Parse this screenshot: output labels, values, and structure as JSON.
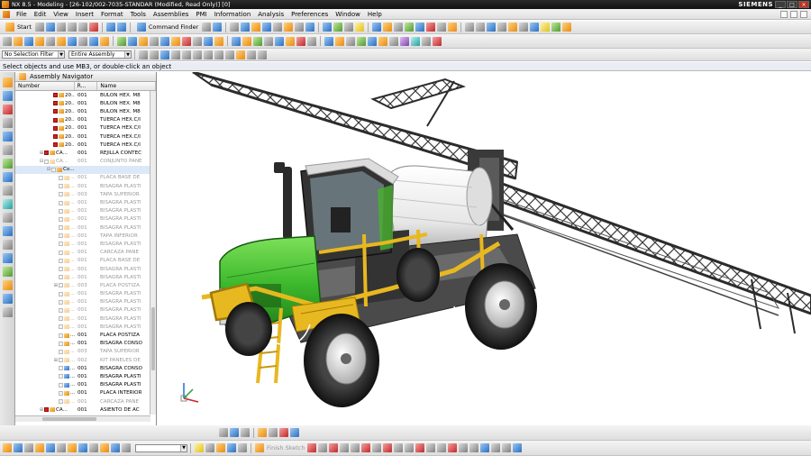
{
  "window": {
    "title": "NX 8.5 - Modeling - [26-102/002-7035-STANDAR (Modified, Read Only)]  [0]",
    "brand": "SIEMENS"
  },
  "menubar": {
    "items": [
      "File",
      "Edit",
      "View",
      "Insert",
      "Format",
      "Tools",
      "Assemblies",
      "PMI",
      "Information",
      "Analysis",
      "Preferences",
      "Window",
      "Help"
    ]
  },
  "toolbar": {
    "start_label": "Start",
    "command_finder_label": "Command Finder"
  },
  "selection_bar": {
    "filter_value": "No Selection Filter",
    "scope_value": "Entire Assembly"
  },
  "cue_line": "Select objects and use MB3, or double-click an object",
  "navigator": {
    "title": "Assembly Navigator",
    "columns": [
      "Number",
      "R...",
      "Name"
    ],
    "rows": [
      {
        "num": "20...",
        "rev": "001",
        "name": "BULON HEX. M8",
        "checked": true,
        "dim": false,
        "exp": ""
      },
      {
        "num": "20...",
        "rev": "001",
        "name": "BULON HEX. M8",
        "checked": true,
        "dim": false,
        "exp": ""
      },
      {
        "num": "20...",
        "rev": "001",
        "name": "BULON HEX. M8",
        "checked": true,
        "dim": false,
        "exp": ""
      },
      {
        "num": "20...",
        "rev": "001",
        "name": "TUERCA HEX.C/I",
        "checked": true,
        "dim": false,
        "exp": ""
      },
      {
        "num": "20...",
        "rev": "001",
        "name": "TUERCA HEX.C/I",
        "checked": true,
        "dim": false,
        "exp": ""
      },
      {
        "num": "20...",
        "rev": "001",
        "name": "TUERCA HEX.C/I",
        "checked": true,
        "dim": false,
        "exp": ""
      },
      {
        "num": "20...",
        "rev": "001",
        "name": "TUERCA HEX.C/I",
        "checked": true,
        "dim": false,
        "exp": ""
      },
      {
        "num": "CA...",
        "rev": "001",
        "name": "REJILLA CONTEC",
        "checked": true,
        "dim": false,
        "exp": "+"
      },
      {
        "num": "CA...",
        "rev": "001",
        "name": "CONJUNTO PANE",
        "checked": false,
        "dim": true,
        "exp": "-"
      },
      {
        "num": "Co...",
        "rev": "",
        "name": "",
        "checked": false,
        "dim": false,
        "exp": "-"
      },
      {
        "num": "...",
        "rev": "001",
        "name": "PLACA BASE DE",
        "checked": false,
        "dim": true,
        "exp": ""
      },
      {
        "num": "...",
        "rev": "001",
        "name": "BISAGRA PLASTI",
        "checked": false,
        "dim": true,
        "exp": ""
      },
      {
        "num": "...",
        "rev": "003",
        "name": "TAPA SUPERIOR",
        "checked": false,
        "dim": true,
        "exp": ""
      },
      {
        "num": "...",
        "rev": "001",
        "name": "BISAGRA PLASTI",
        "checked": false,
        "dim": true,
        "exp": ""
      },
      {
        "num": "...",
        "rev": "001",
        "name": "BISAGRA PLASTI",
        "checked": false,
        "dim": true,
        "exp": ""
      },
      {
        "num": "...",
        "rev": "001",
        "name": "BISAGRA PLASTI",
        "checked": false,
        "dim": true,
        "exp": ""
      },
      {
        "num": "...",
        "rev": "001",
        "name": "BISAGRA PLASTI",
        "checked": false,
        "dim": true,
        "exp": ""
      },
      {
        "num": "...",
        "rev": "001",
        "name": "TAPA INFERIOR",
        "checked": false,
        "dim": true,
        "exp": ""
      },
      {
        "num": "...",
        "rev": "001",
        "name": "BISAGRA PLASTI",
        "checked": false,
        "dim": true,
        "exp": ""
      },
      {
        "num": "...",
        "rev": "001",
        "name": "CARCAZA PANE",
        "checked": false,
        "dim": true,
        "exp": ""
      },
      {
        "num": "...",
        "rev": "001",
        "name": "PLACA BASE DE",
        "checked": false,
        "dim": true,
        "exp": ""
      },
      {
        "num": "...",
        "rev": "001",
        "name": "BISAGRA PLASTI",
        "checked": false,
        "dim": true,
        "exp": ""
      },
      {
        "num": "...",
        "rev": "001",
        "name": "BISAGRA PLASTI",
        "checked": false,
        "dim": true,
        "exp": ""
      },
      {
        "num": "...",
        "rev": "003",
        "name": "PLACA POSTIZA",
        "checked": false,
        "dim": true,
        "exp": "+"
      },
      {
        "num": "...",
        "rev": "001",
        "name": "BISAGRA PLASTI",
        "checked": false,
        "dim": true,
        "exp": ""
      },
      {
        "num": "...",
        "rev": "001",
        "name": "BISAGRA PLASTI",
        "checked": false,
        "dim": true,
        "exp": ""
      },
      {
        "num": "...",
        "rev": "001",
        "name": "BISAGRA PLASTI",
        "checked": false,
        "dim": true,
        "exp": ""
      },
      {
        "num": "...",
        "rev": "001",
        "name": "BISAGRA PLASTI",
        "checked": false,
        "dim": true,
        "exp": ""
      },
      {
        "num": "...",
        "rev": "001",
        "name": "BISAGRA PLASTI",
        "checked": false,
        "dim": true,
        "exp": ""
      },
      {
        "num": "...",
        "rev": "001",
        "name": "PLACA POSTIZA",
        "checked": false,
        "dim": false,
        "exp": ""
      },
      {
        "num": "...",
        "rev": "001",
        "name": "BISAGRA CONSO",
        "checked": false,
        "dim": false,
        "exp": ""
      },
      {
        "num": "...",
        "rev": "003",
        "name": "TAPA SUPERIOR",
        "checked": false,
        "dim": true,
        "exp": ""
      },
      {
        "num": "...",
        "rev": "002",
        "name": "KIT PANELES DE",
        "checked": false,
        "dim": true,
        "exp": "+"
      },
      {
        "num": "...",
        "rev": "001",
        "name": "BISAGRA CONSO",
        "checked": false,
        "dim": false,
        "exp": ""
      },
      {
        "num": "...",
        "rev": "001",
        "name": "BISAGRA PLASTI",
        "checked": false,
        "dim": false,
        "exp": ""
      },
      {
        "num": "...",
        "rev": "001",
        "name": "BISAGRA PLASTI",
        "checked": false,
        "dim": false,
        "exp": ""
      },
      {
        "num": "...",
        "rev": "001",
        "name": "PLACA INTERIOR",
        "checked": false,
        "dim": false,
        "exp": ""
      },
      {
        "num": "...",
        "rev": "001",
        "name": "CARCAZA PANE",
        "checked": false,
        "dim": true,
        "exp": ""
      },
      {
        "num": "CA...",
        "rev": "001",
        "name": "ASIENTO DE AC",
        "checked": true,
        "dim": false,
        "exp": "+"
      }
    ]
  },
  "bottom_toolbar": {
    "finish_sketch_label": "Finish Sketch"
  },
  "icons": {
    "start": "start-icon",
    "command_finder": "command-finder-icon",
    "navigator": "assembly-navigator-icon"
  },
  "colors": {
    "titlebar": "#1a1a1a",
    "tractor_green": "#3cb82c",
    "frame_yellow": "#e8b820",
    "boom_gray": "#3a3a3a"
  }
}
